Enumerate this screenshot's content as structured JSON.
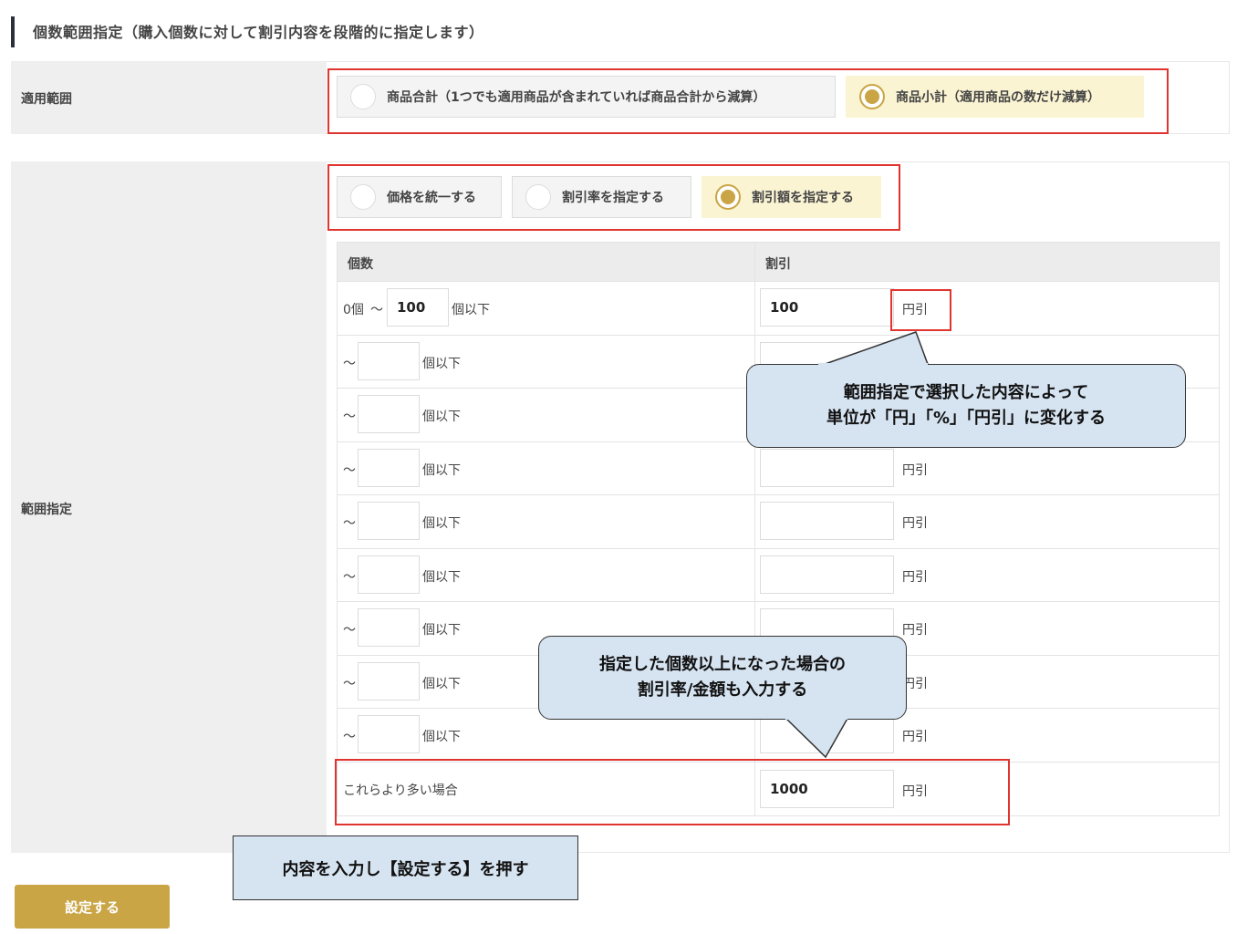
{
  "section_title": "個数範囲指定（購入個数に対して割引内容を段階的に指定します）",
  "scope": {
    "label": "適用範囲",
    "options": [
      {
        "label": "商品合計（1つでも適用商品が含まれていれば商品合計から減算）",
        "selected": false
      },
      {
        "label": "商品小計（適用商品の数だけ減算）",
        "selected": true
      }
    ]
  },
  "range": {
    "label": "範囲指定",
    "type_options": [
      {
        "label": "価格を統一する",
        "selected": false
      },
      {
        "label": "割引率を指定する",
        "selected": false
      },
      {
        "label": "割引額を指定する",
        "selected": true
      }
    ],
    "headers": {
      "count": "個数",
      "discount": "割引"
    },
    "first_row": {
      "start": "0個",
      "tilde": "〜",
      "max": "100",
      "suffix": "個以下",
      "discount": "100",
      "unit": "円引"
    },
    "tilde": "〜",
    "count_suffix": "個以下",
    "unit": "円引",
    "last_row": {
      "label": "これらより多い場合",
      "discount": "1000",
      "unit": "円引"
    }
  },
  "callouts": {
    "unit_note": [
      "範囲指定で選択した内容によって",
      "単位が「円」「%」「円引」に変化する"
    ],
    "last_note": [
      "指定した個数以上になった場合の",
      "割引率/金額も入力する"
    ],
    "submit_note": "内容を入力し【設定する】を押す"
  },
  "submit_label": "設定する"
}
